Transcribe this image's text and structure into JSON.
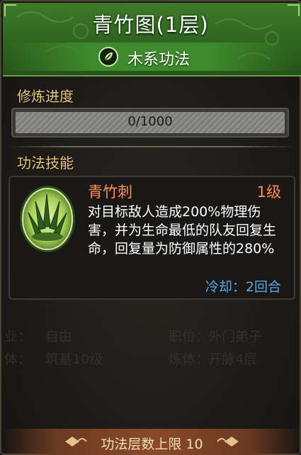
{
  "header": {
    "title": "青竹图(1层)",
    "type_label": "木系功法",
    "type_icon": "leaf-icon"
  },
  "cultivation": {
    "section_label": "修炼进度",
    "progress_text": "0/1000",
    "progress_fraction": 0.0
  },
  "skill": {
    "section_label": "功法技能",
    "name": "青竹刺",
    "level": "1级",
    "description": "对目标敌人造成200%物理伤害，并为生命最低的队友回复生命，回复量为防御属性的280%",
    "cooldown_label": "冷却：",
    "cooldown_value": "2回合",
    "icon": "bamboo-spikes-icon"
  },
  "footer": {
    "text": "功法层数上限 10"
  },
  "colors": {
    "header_green": "#2f6420",
    "section_gold": "#e7c77c",
    "skill_orange": "#ff8e5a",
    "cooldown_blue": "#5aa8e8"
  }
}
